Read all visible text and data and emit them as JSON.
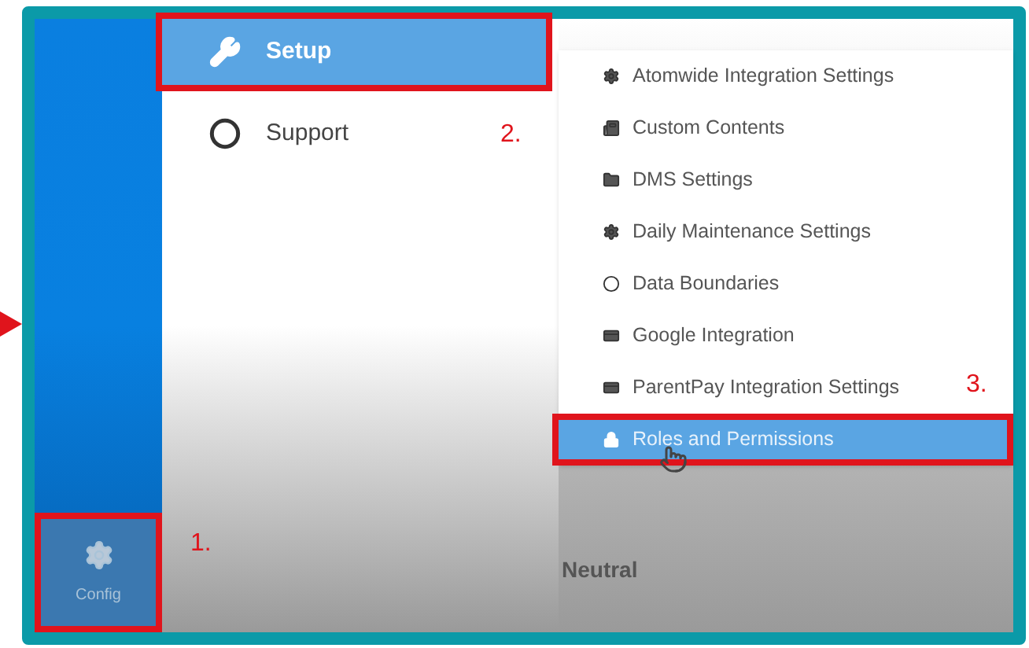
{
  "sidebar": {
    "config": {
      "label": "Config",
      "callout": "1."
    }
  },
  "menu": [
    {
      "label": "Setup",
      "selected": true,
      "callout": "2."
    },
    {
      "label": "Support",
      "selected": false
    }
  ],
  "submenu": [
    {
      "label": "Atomwide Integration Settings",
      "selected": false
    },
    {
      "label": "Custom Contents",
      "selected": false
    },
    {
      "label": "DMS Settings",
      "selected": false
    },
    {
      "label": "Daily Maintenance Settings",
      "selected": false
    },
    {
      "label": "Data Boundaries",
      "selected": false
    },
    {
      "label": "Google Integration",
      "selected": false
    },
    {
      "label": "ParentPay Integration Settings",
      "selected": false
    },
    {
      "label": "Roles and Permissions",
      "selected": true,
      "callout": "3."
    }
  ],
  "content": {
    "heading": "Neutral"
  }
}
